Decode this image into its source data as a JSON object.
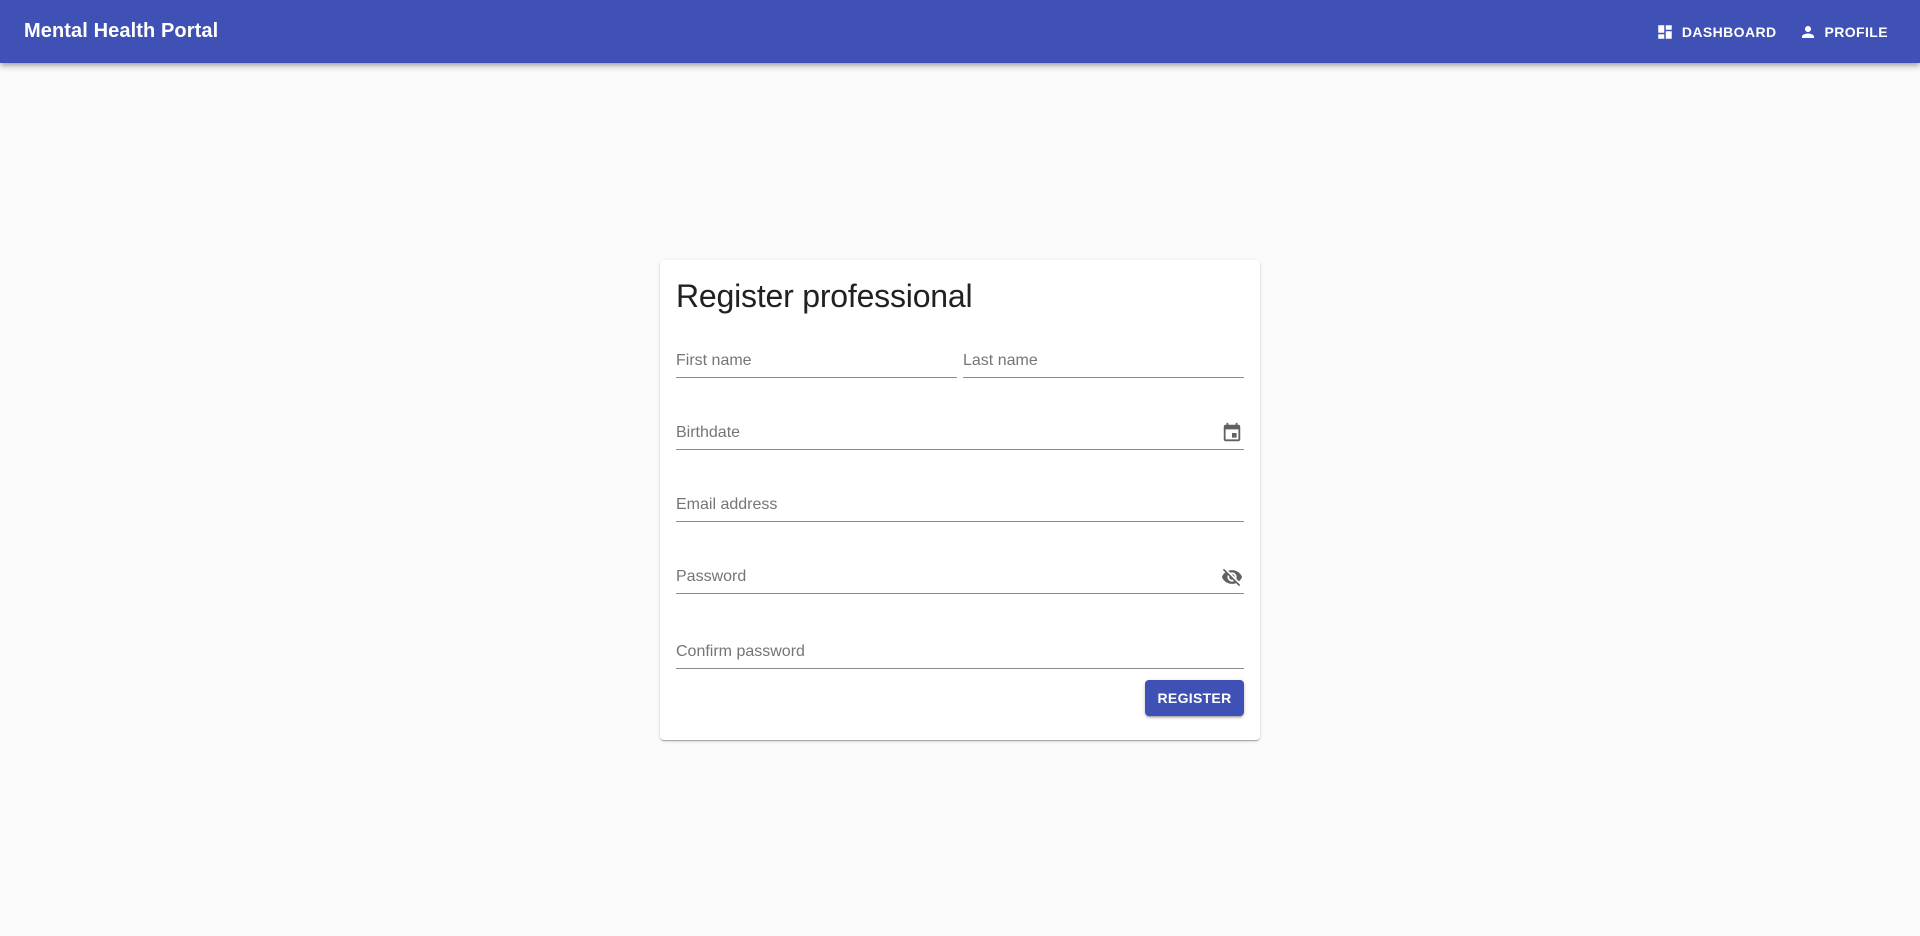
{
  "app": {
    "title": "Mental Health Portal"
  },
  "nav": {
    "dashboard": {
      "label": "DASHBOARD",
      "icon": "dashboard-icon"
    },
    "profile": {
      "label": "PROFILE",
      "icon": "person-icon"
    }
  },
  "form": {
    "title": "Register professional",
    "first_name": {
      "placeholder": "First name",
      "value": ""
    },
    "last_name": {
      "placeholder": "Last name",
      "value": ""
    },
    "birthdate": {
      "placeholder": "Birthdate",
      "value": "",
      "icon": "calendar-icon"
    },
    "email": {
      "placeholder": "Email address",
      "value": ""
    },
    "password": {
      "placeholder": "Password",
      "value": "",
      "icon": "visibility-off-icon"
    },
    "confirm_password": {
      "placeholder": "Confirm password",
      "value": ""
    },
    "submit_label": "REGISTER"
  },
  "colors": {
    "primary": "#3f51b5",
    "background": "#fafafa"
  }
}
